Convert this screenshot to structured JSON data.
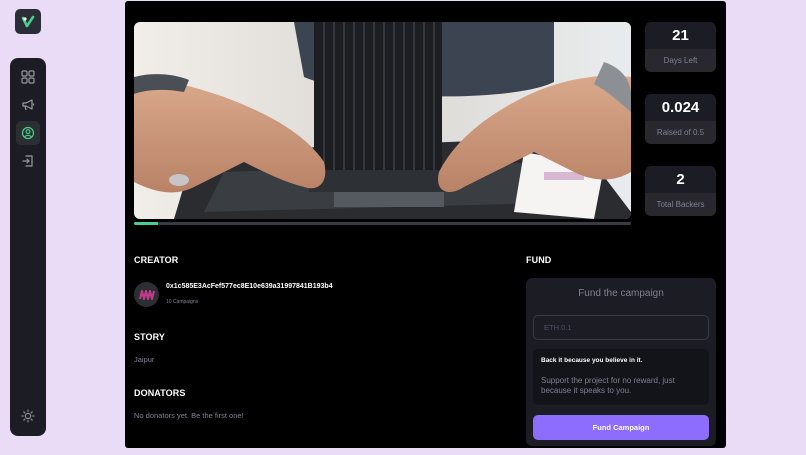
{
  "nav": {
    "logo_icon": "logo-icon",
    "items": [
      {
        "name": "dashboard",
        "icon": "dashboard-icon",
        "active": false
      },
      {
        "name": "campaign",
        "icon": "megaphone-icon",
        "active": false
      },
      {
        "name": "profile",
        "icon": "profile-icon",
        "active": true
      },
      {
        "name": "logout",
        "icon": "logout-icon",
        "active": false
      }
    ],
    "theme_icon": "sun-icon"
  },
  "campaign": {
    "image_icon": "cpu-cooler-photo",
    "progress_fraction": 0.048
  },
  "stats": [
    {
      "value": "21",
      "label": "Days Left"
    },
    {
      "value": "0.024",
      "label": "Raised of 0.5"
    },
    {
      "value": "2",
      "label": "Total Backers"
    }
  ],
  "creator": {
    "title": "CREATOR",
    "address": "0x1c585E3AcFef577ec8E10e639a31997841B193b4",
    "campaigns": "10 Campaigns"
  },
  "story": {
    "title": "STORY",
    "text": "Jaipur"
  },
  "donators": {
    "title": "DONATORS",
    "empty_text": "No donators yet. Be the first one!"
  },
  "fund": {
    "title": "FUND",
    "card_title": "Fund the campaign",
    "input_placeholder": "ETH 0.1",
    "input_value": "",
    "believe_title": "Back it because you believe in it.",
    "believe_text": "Support the project for no reward, just because it speaks to you.",
    "button_label": "Fund Campaign"
  },
  "colors": {
    "accent_green": "#4acd8d",
    "accent_purple": "#8c6dfd",
    "background": "#eadcf7"
  }
}
